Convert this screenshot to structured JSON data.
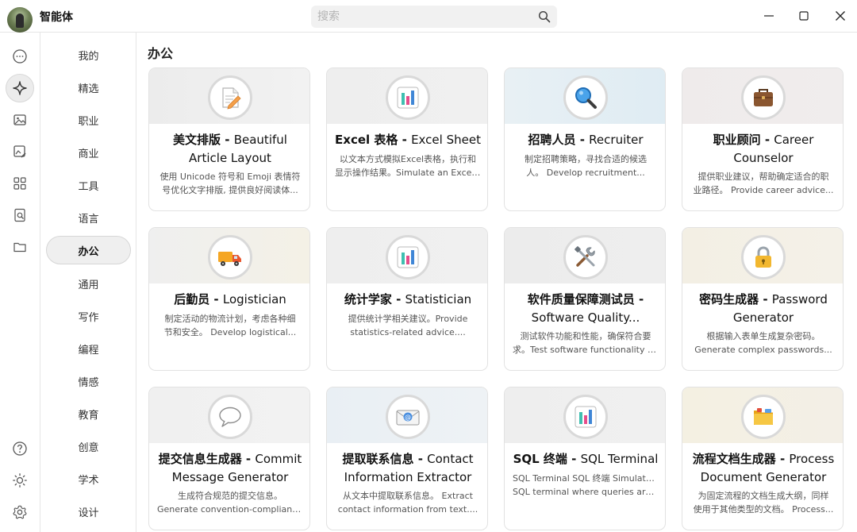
{
  "app": {
    "title": "智能体"
  },
  "search": {
    "placeholder": "搜索"
  },
  "categories": [
    {
      "label": "我的"
    },
    {
      "label": "精选"
    },
    {
      "label": "职业"
    },
    {
      "label": "商业"
    },
    {
      "label": "工具"
    },
    {
      "label": "语言"
    },
    {
      "label": "办公",
      "active": true
    },
    {
      "label": "通用"
    },
    {
      "label": "写作"
    },
    {
      "label": "编程"
    },
    {
      "label": "情感"
    },
    {
      "label": "教育"
    },
    {
      "label": "创意"
    },
    {
      "label": "学术"
    },
    {
      "label": "设计"
    }
  ],
  "rail_icons": [
    "chat-icon",
    "sparkle-icon",
    "image-icon",
    "image-edit-icon",
    "apps-icon",
    "document-search-icon",
    "folder-icon",
    "help-icon",
    "brightness-icon",
    "settings-icon"
  ],
  "section": {
    "title": "办公"
  },
  "cards": [
    {
      "icon": "memo-icon",
      "title_cn": "美文排版",
      "title_en": "Beautiful Article Layout",
      "desc1": "使用 Unicode 符号和 Emoji 表情符",
      "desc2": "号优化文字排版, 提供良好阅读体..."
    },
    {
      "icon": "bar-chart-icon",
      "title_cn": "Excel 表格",
      "title_en": "Excel Sheet",
      "desc1": "以文本方式模拟Excel表格，执行和",
      "desc2": "显示操作结果。Simulate an Excel..."
    },
    {
      "icon": "magnifier-icon",
      "title_cn": "招聘人员",
      "title_en": "Recruiter",
      "desc1": "制定招聘策略，寻找合适的候选",
      "desc2": "人。 Develop recruitment..."
    },
    {
      "icon": "briefcase-icon",
      "title_cn": "职业顾问",
      "title_en": "Career Counselor",
      "desc1": "提供职业建议，帮助确定适合的职",
      "desc2": "业路径。 Provide career advice..."
    },
    {
      "icon": "delivery-truck-icon",
      "title_cn": "后勤员",
      "title_en": "Logistician",
      "desc1": "制定活动的物流计划，考虑各种细",
      "desc2": "节和安全。 Develop logistical..."
    },
    {
      "icon": "bar-chart-icon",
      "title_cn": "统计学家",
      "title_en": "Statistician",
      "desc1": "提供统计学相关建议。Provide",
      "desc2": "statistics-related advice...."
    },
    {
      "icon": "tools-icon",
      "title_cn": "软件质量保障测试员",
      "title_en": "Software Quality...",
      "desc1": "测试软件功能和性能，确保符合要",
      "desc2": "求。Test software functionality a..."
    },
    {
      "icon": "lock-icon",
      "title_cn": "密码生成器",
      "title_en": "Password Generator",
      "desc1": "根据输入表单生成复杂密码。",
      "desc2": "Generate complex passwords..."
    },
    {
      "icon": "speech-bubble-icon",
      "title_cn": "提交信息生成器",
      "title_en": "Commit Message Generator",
      "desc1": "生成符合规范的提交信息。",
      "desc2": "Generate convention-compliant..."
    },
    {
      "icon": "email-icon",
      "title_cn": "提取联系信息",
      "title_en": "Contact Information Extractor",
      "desc1": "从文本中提取联系信息。 Extract",
      "desc2": "contact information from text...."
    },
    {
      "icon": "bar-chart-icon",
      "title_cn": "SQL 终端",
      "title_en": "SQL Terminal",
      "desc1": "SQL Terminal SQL 终端 Simulate a",
      "desc2": "SQL terminal where queries are..."
    },
    {
      "icon": "folder-icon",
      "title_cn": "流程文档生成器",
      "title_en": "Process Document Generator",
      "desc1": "为固定流程的文档生成大纲，同样",
      "desc2": "使用于其他类型的文档。 Process..."
    }
  ]
}
